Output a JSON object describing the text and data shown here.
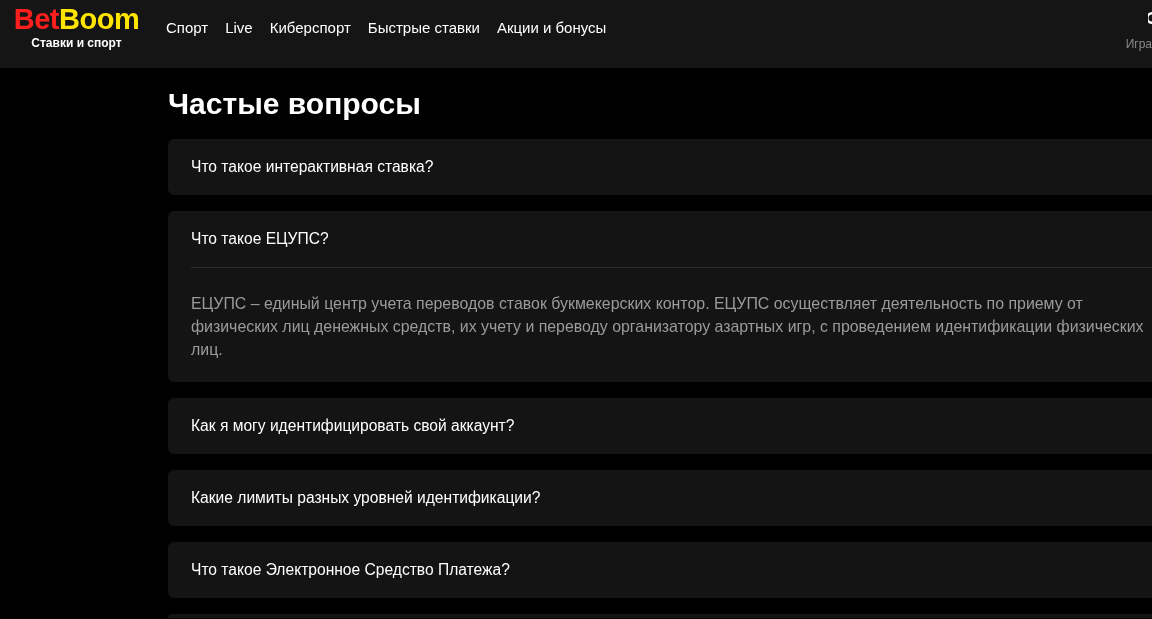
{
  "header": {
    "logo": {
      "part_1": "Bet",
      "part_2": "Boom",
      "tagline": "Ставки и спорт"
    },
    "nav": [
      {
        "label": "Спорт"
      },
      {
        "label": "Live"
      },
      {
        "label": "Киберспорт"
      },
      {
        "label": "Быстрые ставки"
      },
      {
        "label": "Акции и бонусы"
      }
    ],
    "account_hint": "Игра"
  },
  "faq": {
    "title": "Частые вопросы",
    "items": [
      {
        "question": "Что такое интерактивная ставка?",
        "expanded": false
      },
      {
        "question": "Что такое ЕЦУПС?",
        "expanded": true,
        "answer": "ЕЦУПС – единый центр учета переводов ставок букмекерских контор. ЕЦУПС осуществляет деятельность по приему от физических лиц денежных средств, их учету и переводу организатору азартных игр, с проведением идентификации физических лиц."
      },
      {
        "question": "Как я могу идентифицировать свой аккаунт?",
        "expanded": false
      },
      {
        "question": "Какие лимиты разных уровней идентификации?",
        "expanded": false
      },
      {
        "question": "Что такое Электронное Средство Платежа?",
        "expanded": false
      }
    ]
  }
}
